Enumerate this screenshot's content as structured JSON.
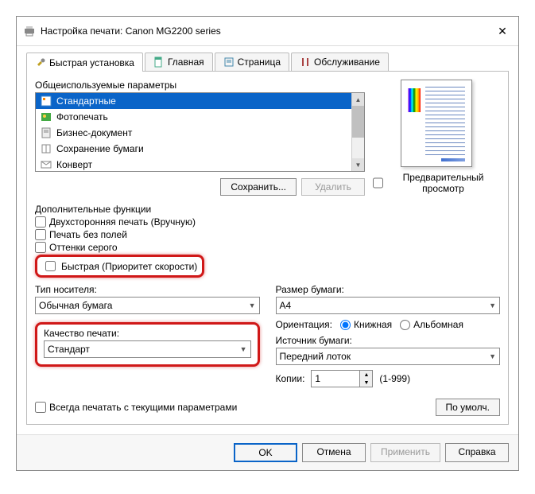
{
  "window": {
    "title": "Настройка печати: Canon MG2200 series"
  },
  "tabs": [
    {
      "label": "Быстрая установка",
      "active": true
    },
    {
      "label": "Главная"
    },
    {
      "label": "Страница"
    },
    {
      "label": "Обслуживание"
    }
  ],
  "presets": {
    "label": "Общеиспользуемые параметры",
    "items": [
      {
        "label": "Стандартные",
        "selected": true
      },
      {
        "label": "Фотопечать"
      },
      {
        "label": "Бизнес-документ"
      },
      {
        "label": "Сохранение бумаги"
      },
      {
        "label": "Конверт"
      }
    ],
    "save_btn": "Сохранить...",
    "delete_btn": "Удалить"
  },
  "preview": {
    "checkbox_label": "Предварительный просмотр"
  },
  "extras": {
    "label": "Дополнительные функции",
    "duplex": "Двухсторонняя печать (Вручную)",
    "borderless": "Печать без полей",
    "grayscale": "Оттенки серого",
    "fast": "Быстрая (Приоритет скорости)"
  },
  "media": {
    "label": "Тип носителя:",
    "value": "Обычная бумага"
  },
  "quality": {
    "label": "Качество печати:",
    "value": "Стандарт"
  },
  "paper_size": {
    "label": "Размер бумаги:",
    "value": "A4"
  },
  "orientation": {
    "label": "Ориентация:",
    "portrait": "Книжная",
    "landscape": "Альбомная"
  },
  "source": {
    "label": "Источник бумаги:",
    "value": "Передний лоток"
  },
  "copies": {
    "label": "Копии:",
    "value": "1",
    "range": "(1-999)"
  },
  "always": {
    "label": "Всегда печатать с текущими параметрами"
  },
  "defaults_btn": "По умолч.",
  "buttons": {
    "ok": "OK",
    "cancel": "Отмена",
    "apply": "Применить",
    "help": "Справка"
  }
}
